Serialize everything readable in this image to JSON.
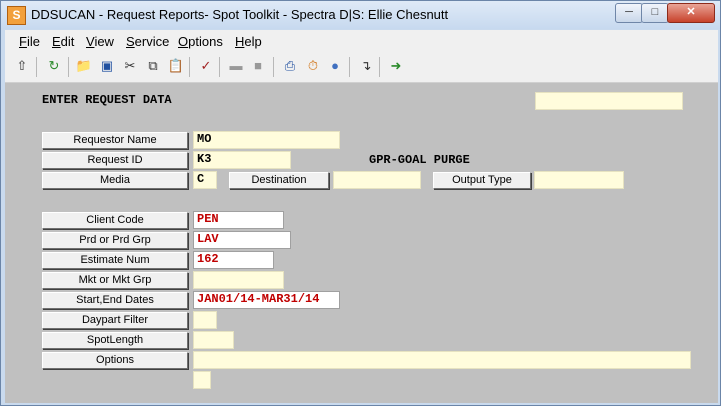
{
  "window": {
    "title": "DDSUCAN - Request Reports- Spot Toolkit - Spectra D|S: Ellie Chesnutt",
    "icon_letter": "S"
  },
  "menu": [
    "File",
    "Edit",
    "View",
    "Service",
    "Options",
    "Help"
  ],
  "toolbar": [
    "export-icon",
    "refresh-icon",
    "open-folder-icon",
    "save-icon",
    "cut-icon",
    "copy-icon",
    "paste-icon",
    "spellcheck-icon",
    "disabled-icon",
    "disabled-icon",
    "print-icon",
    "timer-icon",
    "users-icon",
    "exit-icon",
    "logout-icon"
  ],
  "form": {
    "header": "ENTER REQUEST DATA",
    "top_right_value": "",
    "requestor_name": {
      "label": "Requestor Name",
      "value": "MO"
    },
    "request_id": {
      "label": "Request ID",
      "value": "K3"
    },
    "request_desc": "GPR-GOAL PURGE",
    "media": {
      "label": "Media",
      "value": "C"
    },
    "destination": {
      "label": "Destination",
      "value": ""
    },
    "output_type": {
      "label": "Output Type",
      "value": ""
    },
    "client_code": {
      "label": "Client Code",
      "value": "PEN"
    },
    "product": {
      "label": "Prd or Prd Grp",
      "value": "LAV"
    },
    "estimate": {
      "label": "Estimate Num",
      "value": "162"
    },
    "market": {
      "label": "Mkt or Mkt Grp",
      "value": ""
    },
    "dates": {
      "label": "Start,End Dates",
      "value": "JAN01/14-MAR31/14"
    },
    "daypart": {
      "label": "Daypart Filter",
      "value": ""
    },
    "spot_length": {
      "label": "SpotLength",
      "value": ""
    },
    "options": {
      "label": "Options",
      "value": ""
    },
    "extra_value": ""
  }
}
